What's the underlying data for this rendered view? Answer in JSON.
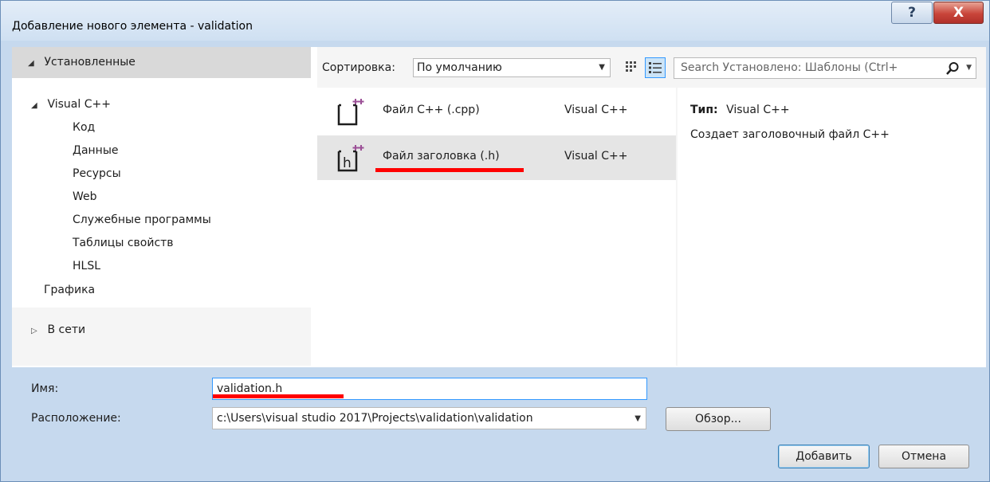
{
  "window": {
    "title": "Добавление нового элемента  - validation",
    "help_label": "?",
    "close_label": "X"
  },
  "left": {
    "installed": "Установленные",
    "tree": {
      "root": "Visual C++",
      "children": [
        "Код",
        "Данные",
        "Ресурсы",
        "Web",
        "Служебные программы",
        "Таблицы свойств",
        "HLSL"
      ],
      "graphics": "Графика"
    },
    "online": "В сети"
  },
  "toolbar": {
    "sort_label": "Сортировка:",
    "sort_value": "По умолчанию",
    "search_placeholder": "Search Установлено: Шаблоны (Ctrl+"
  },
  "templates": [
    {
      "name": "Файл C++ (.cpp)",
      "lang": "Visual C++",
      "icon": "cpp-file-icon"
    },
    {
      "name": "Файл заголовка (.h)",
      "lang": "Visual C++",
      "icon": "header-file-icon"
    }
  ],
  "details": {
    "type_label": "Тип:",
    "type_value": "Visual C++",
    "description": "Создает заголовочный файл C++"
  },
  "form": {
    "name_label": "Имя:",
    "name_value": "validation.h",
    "location_label": "Расположение:",
    "location_value": "c:\\Users\\visual studio 2017\\Projects\\validation\\validation",
    "browse_label": "Обзор...",
    "add_label": "Добавить",
    "cancel_label": "Отмена"
  },
  "colors": {
    "frame": "#c6d9ee",
    "selection": "#e5e5e5",
    "accent": "#3399ff",
    "annotation": "#ff0000"
  }
}
